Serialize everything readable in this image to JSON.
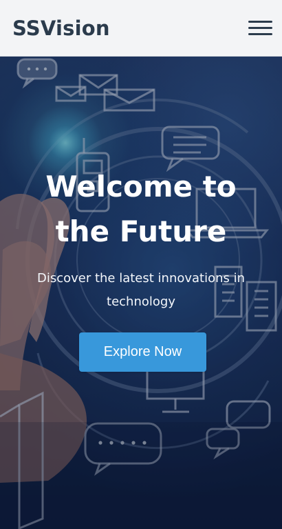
{
  "header": {
    "brand": "SSVision",
    "menu_icon": "hamburger-menu-icon"
  },
  "hero": {
    "title": "Welcome to the Future",
    "subtitle": "Discover the latest innovations in technology",
    "cta_label": "Explore Now"
  },
  "colors": {
    "header_bg": "#f3f4f6",
    "brand_text": "#2b3b4c",
    "cta_bg": "#3898db",
    "hero_text": "#ffffff"
  },
  "icons": {
    "background_icons": [
      "chat-bubble-icon",
      "mail-icon",
      "walkie-talkie-icon",
      "message-icon",
      "laptop-icon",
      "server-icon",
      "monitor-icon",
      "speech-bubbles-icon"
    ]
  }
}
